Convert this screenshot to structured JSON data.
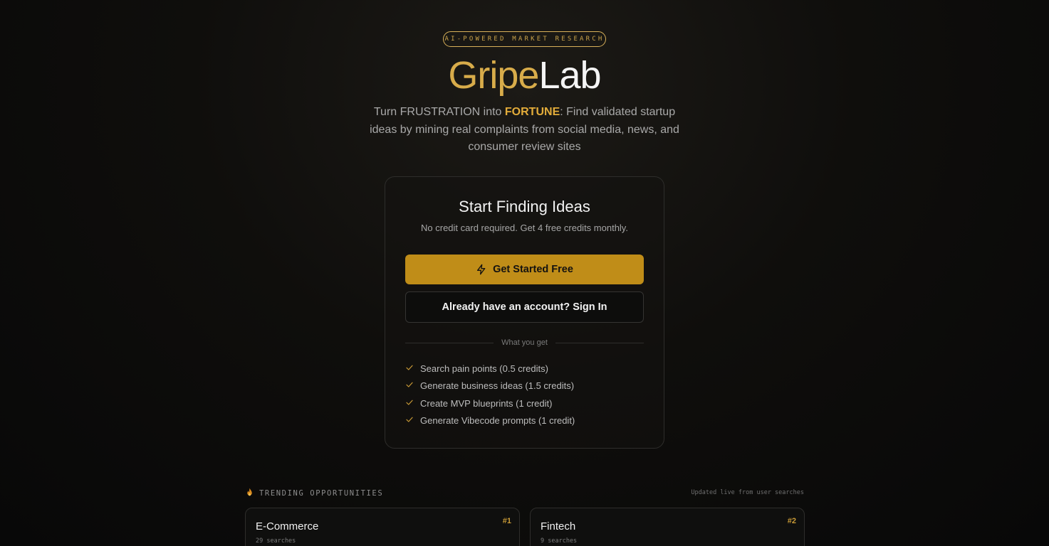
{
  "hero": {
    "badge": "AI-POWERED MARKET RESEARCH",
    "brand_part1": "Gripe",
    "brand_part2": "Lab",
    "tagline_pre": "Turn FRUSTRATION into ",
    "tagline_strong": "FORTUNE",
    "tagline_post": ": Find validated startup ideas by mining real complaints from social media, news, and consumer review sites"
  },
  "signup_card": {
    "title": "Start Finding Ideas",
    "subtitle": "No credit card required. Get 4 free credits monthly.",
    "primary_button": "Get Started Free",
    "primary_icon": "lightning-icon",
    "secondary_button": "Already have an account? Sign In",
    "divider_label": "What you get",
    "features": [
      "Search pain points (0.5 credits)",
      "Generate business ideas (1.5 credits)",
      "Create MVP blueprints (1 credit)",
      "Generate Vibecode prompts (1 credit)"
    ]
  },
  "trending": {
    "icon": "flame-icon",
    "title": "TRENDING OPPORTUNITIES",
    "updated": "Updated live from user searches",
    "cards": [
      {
        "name": "E-Commerce",
        "searches": "29 searches",
        "rank": "#1"
      },
      {
        "name": "Fintech",
        "searches": "9 searches",
        "rank": "#2"
      }
    ]
  },
  "colors": {
    "accent_gold": "#c08d18",
    "brand_gold": "#d8ac4a",
    "tagline_highlight": "#e3ac3a",
    "background": "#0d0c0b"
  }
}
